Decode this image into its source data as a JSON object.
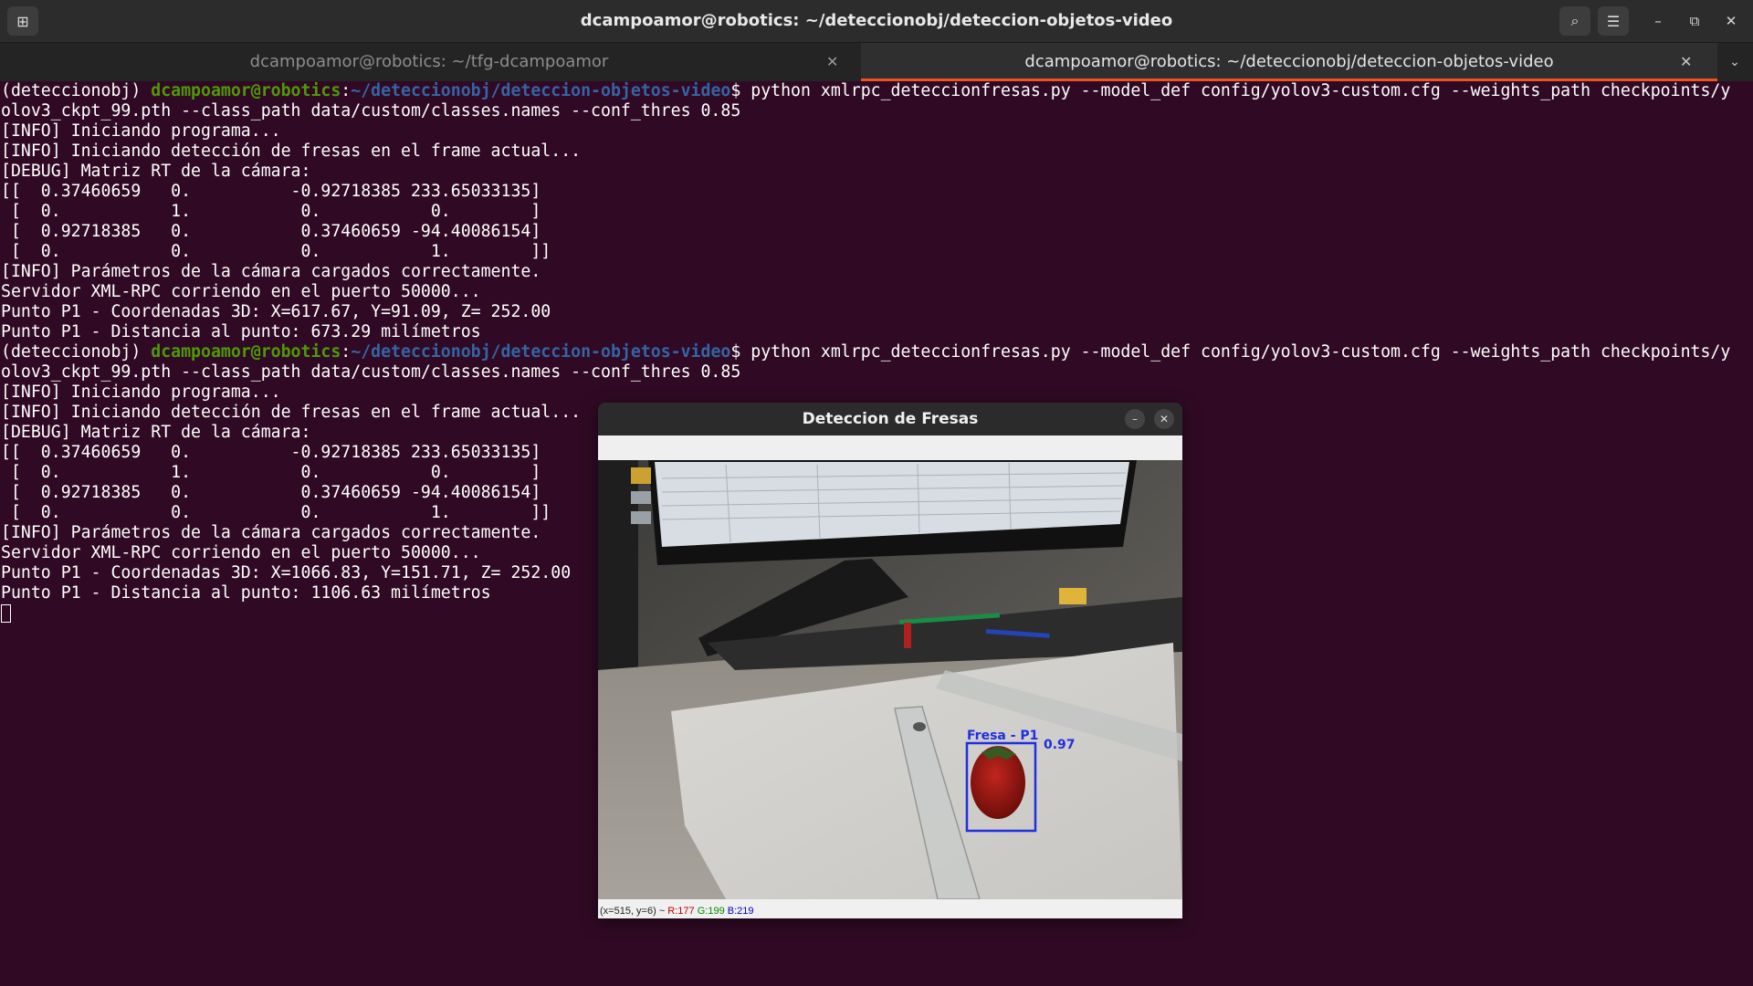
{
  "window": {
    "title": "dcampoamor@robotics: ~/deteccionobj/deteccion-objetos-video"
  },
  "tabs": [
    {
      "label": "dcampoamor@robotics: ~/tfg-dcampoamor",
      "active": false
    },
    {
      "label": "dcampoamor@robotics: ~/deteccionobj/deteccion-objetos-video",
      "active": true
    }
  ],
  "icons": {
    "new_tab": "new-tab-icon",
    "search": "search-icon",
    "menu": "hamburger-menu-icon",
    "minimize": "minimize-icon",
    "maximize": "maximize-icon",
    "close": "close-icon",
    "tab_close": "close-icon",
    "tab_dropdown": "chevron-down-icon"
  },
  "glyphs": {
    "new_tab": "⊞",
    "search": "⌕",
    "menu": "☰",
    "minimize": "–",
    "maximize": "⧉",
    "close": "✕",
    "chevron": "⌄"
  },
  "colors": {
    "terminal_bg": "#300a24",
    "prompt_user": "#4e9a06",
    "prompt_path": "#3465a4",
    "tab_accent": "#e95420",
    "bbox": "#1f2fe0"
  },
  "terminal": {
    "run1": {
      "env": "(deteccionobj) ",
      "user": "dcampoamor@robotics",
      "colon": ":",
      "path": "~/deteccionobj/deteccion-objetos-video",
      "dollar": "$ ",
      "cmd": "python xmlrpc_deteccionfresas.py --model_def config/yolov3-custom.cfg --weights_path checkpoints/y",
      "cmd_cont": "olov3_ckpt_99.pth --class_path data/custom/classes.names --conf_thres 0.85",
      "out": [
        "[INFO] Iniciando programa...",
        "[INFO] Iniciando detección de fresas en el frame actual...",
        "[DEBUG] Matriz RT de la cámara:",
        "[[  0.37460659   0.          -0.92718385 233.65033135]",
        " [  0.           1.           0.           0.        ]",
        " [  0.92718385   0.           0.37460659 -94.40086154]",
        " [  0.           0.           0.           1.        ]]",
        "[INFO] Parámetros de la cámara cargados correctamente.",
        "Servidor XML-RPC corriendo en el puerto 50000...",
        "Punto P1 - Coordenadas 3D: X=617.67, Y=91.09, Z= 252.00",
        "Punto P1 - Distancia al punto: 673.29 milímetros"
      ]
    },
    "run2": {
      "env": "(deteccionobj) ",
      "user": "dcampoamor@robotics",
      "colon": ":",
      "path": "~/deteccionobj/deteccion-objetos-video",
      "dollar": "$ ",
      "cmd": "python xmlrpc_deteccionfresas.py --model_def config/yolov3-custom.cfg --weights_path checkpoints/y",
      "cmd_cont": "olov3_ckpt_99.pth --class_path data/custom/classes.names --conf_thres 0.85",
      "out": [
        "[INFO] Iniciando programa...",
        "[INFO] Iniciando detección de fresas en el frame actual...",
        "[DEBUG] Matriz RT de la cámara:",
        "[[  0.37460659   0.          -0.92718385 233.65033135]",
        " [  0.           1.           0.           0.        ]",
        " [  0.92718385   0.           0.37460659 -94.40086154]",
        " [  0.           0.           0.           1.        ]]",
        "[INFO] Parámetros de la cámara cargados correctamente.",
        "Servidor XML-RPC corriendo en el puerto 50000...",
        "Punto P1 - Coordenadas 3D: X=1066.83, Y=151.71, Z= 252.00",
        "Punto P1 - Distancia al punto: 1106.63 milímetros"
      ]
    }
  },
  "detection_window": {
    "title": "Deteccion de Fresas",
    "detection_label": "Fresa - P1",
    "confidence": "0.97",
    "status": {
      "coords": "(x=515, y=6) ~ ",
      "r": "R:177",
      "g": "G:199",
      "b": "B:219"
    }
  }
}
